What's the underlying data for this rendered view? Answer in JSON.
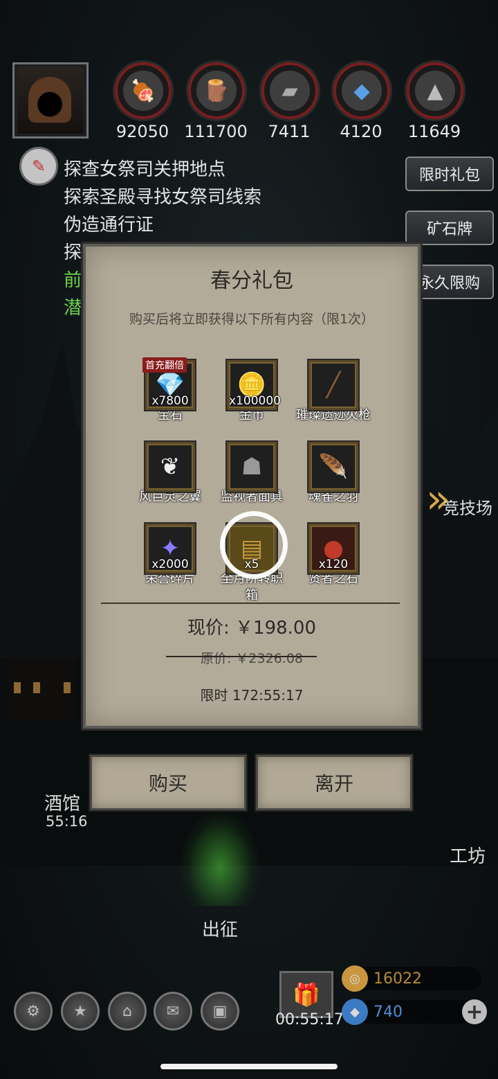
{
  "resources": [
    {
      "icon": "meat-icon",
      "value": "92050"
    },
    {
      "icon": "wood-icon",
      "value": "111700"
    },
    {
      "icon": "iron-icon",
      "value": "7411"
    },
    {
      "icon": "crystal-icon",
      "value": "4120"
    },
    {
      "icon": "ore-icon",
      "value": "11649"
    }
  ],
  "quests": [
    {
      "text": "探查女祭司关押地点",
      "color": "white"
    },
    {
      "text": "探索圣殿寻找女祭司线索",
      "color": "white"
    },
    {
      "text": "伪造通行证",
      "color": "white"
    },
    {
      "text": "探",
      "color": "white"
    },
    {
      "text": "前",
      "color": "green"
    },
    {
      "text": "潜",
      "color": "green"
    }
  ],
  "side_buttons": {
    "limited_gift": "限时礼包",
    "ore_token": "矿石牌",
    "permanent_limited": "永久限购"
  },
  "map_labels": {
    "arena": "竞技场",
    "tavern": "酒馆",
    "tavern_timer": "55:16",
    "workshop": "工坊",
    "expedition": "出征"
  },
  "modal": {
    "title": "春分礼包",
    "description": "购买后将立即获得以下所有内容（限1次）",
    "first_charge_badge": "首充翻倍",
    "items": [
      {
        "name": "宝石",
        "qty": "x7800",
        "icon": "gem-icon"
      },
      {
        "name": "金币",
        "qty": "x100000",
        "icon": "gold-coins-icon"
      },
      {
        "name": "璀璨遗迹火枪",
        "qty": "",
        "icon": "musket-icon"
      },
      {
        "name": "风巨灵之翼",
        "qty": "",
        "icon": "wing-icon"
      },
      {
        "name": "监视者面具",
        "qty": "",
        "icon": "mask-icon"
      },
      {
        "name": "魂雀之羽",
        "qty": "",
        "icon": "feather-icon"
      },
      {
        "name": "荣誉碎片",
        "qty": "x2000",
        "icon": "honor-shard-icon"
      },
      {
        "name": "全月阶转职箱",
        "qty": "x5",
        "icon": "chest-icon"
      },
      {
        "name": "贤者之石",
        "qty": "x120",
        "icon": "sage-stone-icon"
      }
    ],
    "current_price": "现价: ￥198.00",
    "original_price": "原价: ￥2326.08",
    "time_limit": "限时 172:55:17"
  },
  "buttons": {
    "buy": "购买",
    "leave": "离开"
  },
  "bottom_bar": {
    "gift_timer": "00:55:17",
    "gold": "16022",
    "gems": "740"
  },
  "colors": {
    "quest_green": "#6bd34a",
    "badge_red": "#8a1c1c",
    "modal_bg": "#b3ab9a",
    "gold_text": "#b8893a",
    "gem_text": "#4f8fd6"
  }
}
